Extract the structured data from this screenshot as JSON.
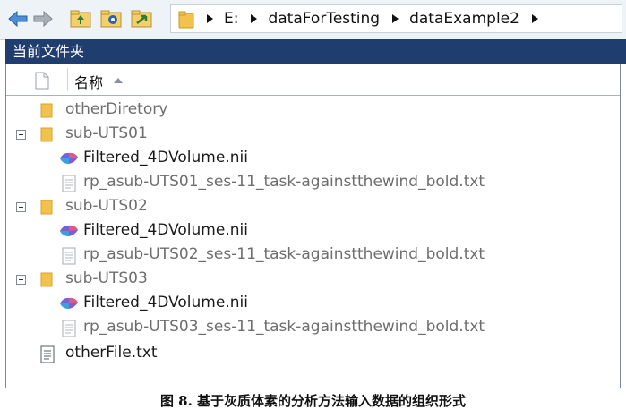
{
  "address_bar": {
    "crumbs": [
      "E:",
      "dataForTesting",
      "dataExample2"
    ]
  },
  "panel": {
    "title": "当前文件夹",
    "column_name": "名称",
    "sort": "ascending"
  },
  "tree": {
    "other_directory": "otherDiretory",
    "groups": [
      {
        "folder": "sub-UTS01",
        "nii": "Filtered_4DVolume.nii",
        "txt": "rp_asub-UTS01_ses-11_task-againstthewind_bold.txt"
      },
      {
        "folder": "sub-UTS02",
        "nii": "Filtered_4DVolume.nii",
        "txt": "rp_asub-UTS02_ses-11_task-againstthewind_bold.txt"
      },
      {
        "folder": "sub-UTS03",
        "nii": "Filtered_4DVolume.nii",
        "txt": "rp_asub-UTS03_ses-11_task-againstthewind_bold.txt"
      }
    ],
    "other_file": "otherFile.txt"
  },
  "caption": "图 8. 基于灰质体素的分析方法输入数据的组织形式",
  "colors": {
    "panel_header": "#1f3d6e",
    "folder": "#f2c14e",
    "toolbar": "#eef3f8"
  },
  "icons": [
    "back-arrow-icon",
    "forward-arrow-icon",
    "folder-up-icon",
    "browse-folder-icon",
    "refresh-folder-icon",
    "folder-icon",
    "document-icon",
    "nii-volume-icon",
    "text-file-icon"
  ]
}
